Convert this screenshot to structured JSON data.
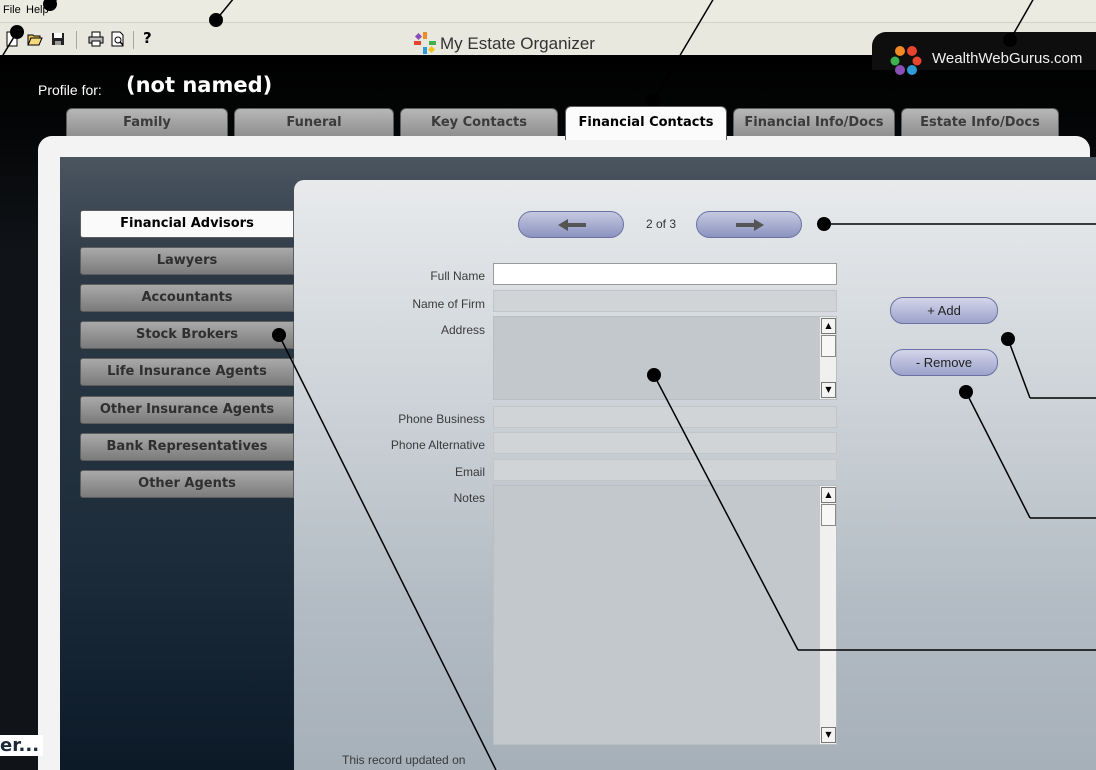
{
  "menu": {
    "file": "File",
    "help": "Help"
  },
  "toolbar": {
    "icons": [
      "new-icon",
      "open-icon",
      "save-icon",
      "print-icon",
      "print-preview-icon",
      "help-icon"
    ],
    "help_glyph": "?"
  },
  "app": {
    "title": "My Estate Organizer"
  },
  "brand": {
    "name": "WealthWebGurus.com",
    "dot_colors": [
      "#f08a24",
      "#e8452f",
      "#3fb24f",
      "#2e9bd6",
      "#8a4fb7"
    ]
  },
  "profile": {
    "label": "Profile for:",
    "name": "(not named)"
  },
  "tabs": [
    {
      "label": "Family",
      "active": false
    },
    {
      "label": "Funeral",
      "active": false
    },
    {
      "label": "Key Contacts",
      "active": false
    },
    {
      "label": "Financial Contacts",
      "active": true
    },
    {
      "label": "Financial Info/Docs",
      "active": false
    },
    {
      "label": "Estate Info/Docs",
      "active": false
    }
  ],
  "sidebar": {
    "items": [
      {
        "label": "Financial Advisors",
        "active": true
      },
      {
        "label": "Lawyers",
        "active": false
      },
      {
        "label": "Accountants",
        "active": false
      },
      {
        "label": "Stock Brokers",
        "active": false
      },
      {
        "label": "Life Insurance Agents",
        "active": false
      },
      {
        "label": "Other Insurance Agents",
        "active": false
      },
      {
        "label": "Bank Representatives",
        "active": false
      },
      {
        "label": "Other Agents",
        "active": false
      }
    ]
  },
  "record": {
    "counter": "2 of 3"
  },
  "form": {
    "full_name_label": "Full Name",
    "firm_label": "Name of Firm",
    "address_label": "Address",
    "phone_business_label": "Phone Business",
    "phone_alt_label": "Phone Alternative",
    "email_label": "Email",
    "notes_label": "Notes",
    "full_name": "",
    "firm": "",
    "address": "",
    "phone_business": "",
    "phone_alt": "",
    "email": "",
    "notes": ""
  },
  "actions": {
    "add": "+ Add",
    "remove": "- Remove"
  },
  "footer": {
    "updated": "This record updated on"
  },
  "clipped_text": "er...",
  "colors": {
    "accent": "#9ca2cb",
    "dark_bg": "#0a141e",
    "panel": "#f3f3f3"
  }
}
